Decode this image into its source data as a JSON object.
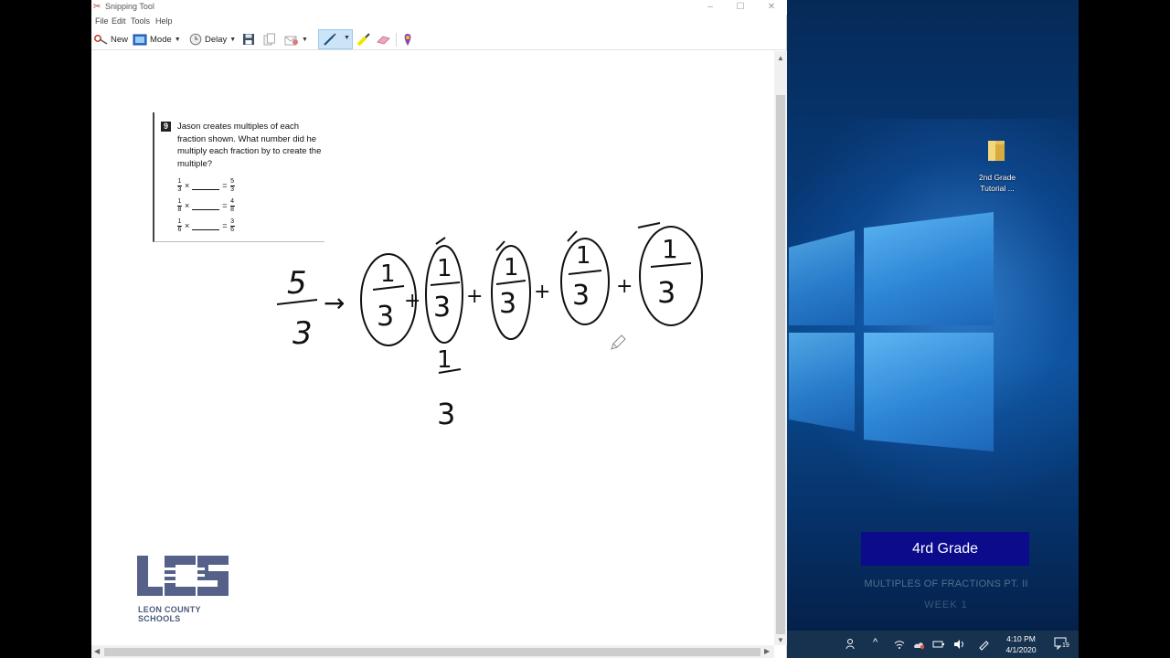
{
  "window": {
    "title": "Snipping Tool",
    "controls": {
      "minimize": "–",
      "maximize": "☐",
      "close": "✕"
    }
  },
  "menu": [
    "File",
    "Edit",
    "Tools",
    "Help"
  ],
  "toolbar": {
    "new_label": "New",
    "mode_label": "Mode",
    "delay_label": "Delay"
  },
  "problem": {
    "number": "9",
    "text": "Jason creates multiples of each fraction shown. What number did he multiply each fraction by to create the multiple?",
    "equations": [
      {
        "left_num": "1",
        "left_den": "3",
        "times": "×",
        "equals": "=",
        "right_num": "5",
        "right_den": "3"
      },
      {
        "left_num": "1",
        "left_den": "8",
        "times": "×",
        "equals": "=",
        "right_num": "4",
        "right_den": "8"
      },
      {
        "left_num": "1",
        "left_den": "6",
        "times": "×",
        "equals": "=",
        "right_num": "3",
        "right_den": "6"
      }
    ]
  },
  "handwriting": {
    "result_num": "5",
    "result_den": "3",
    "unit_num": "1",
    "unit_den": "3",
    "arrow": "→",
    "plus": "+"
  },
  "logo": {
    "caption": "LEON COUNTY SCHOOLS",
    "letters": "LCS"
  },
  "desktop": {
    "folder_label": "2nd Grade Tutorial ...",
    "grade_title": "4rd Grade",
    "subtitle_line1": "MULTIPLES OF FRACTIONS PT. II",
    "subtitle_line2": "WEEK 1"
  },
  "taskbar": {
    "time": "4:10 PM",
    "date": "4/1/2020",
    "notification_count": "19"
  },
  "colors": {
    "grade_box": "#0c0b8c",
    "desktop_bg": "#073b7a",
    "taskbar": "#16324f",
    "pen_highlight": "#cce4f7"
  }
}
